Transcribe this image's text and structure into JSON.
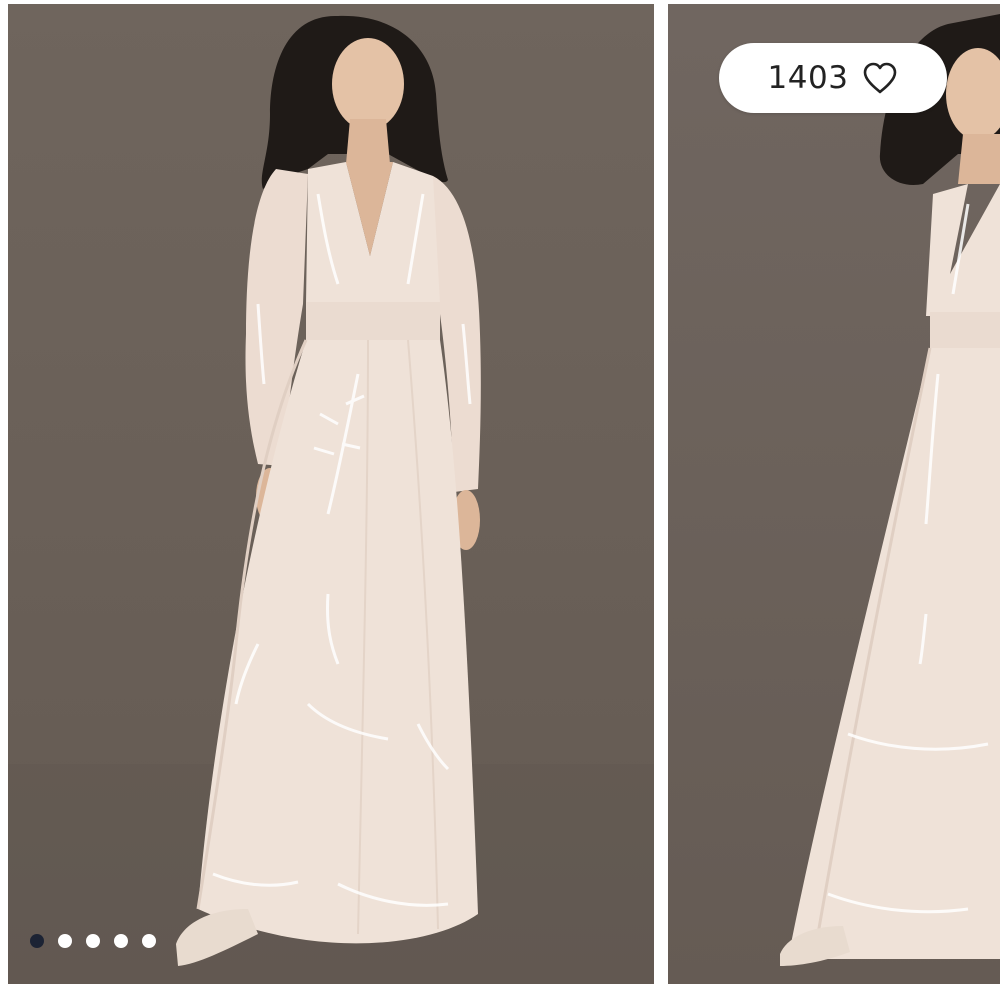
{
  "likes": {
    "count": "1403",
    "icon": "heart-icon"
  },
  "carousel": {
    "slide_count": 5,
    "active_index": 0
  },
  "colors": {
    "background": "#6b615a",
    "dress": "#efe2d8",
    "active_dot": "#1c2334",
    "inactive_dot": "#ffffff"
  }
}
